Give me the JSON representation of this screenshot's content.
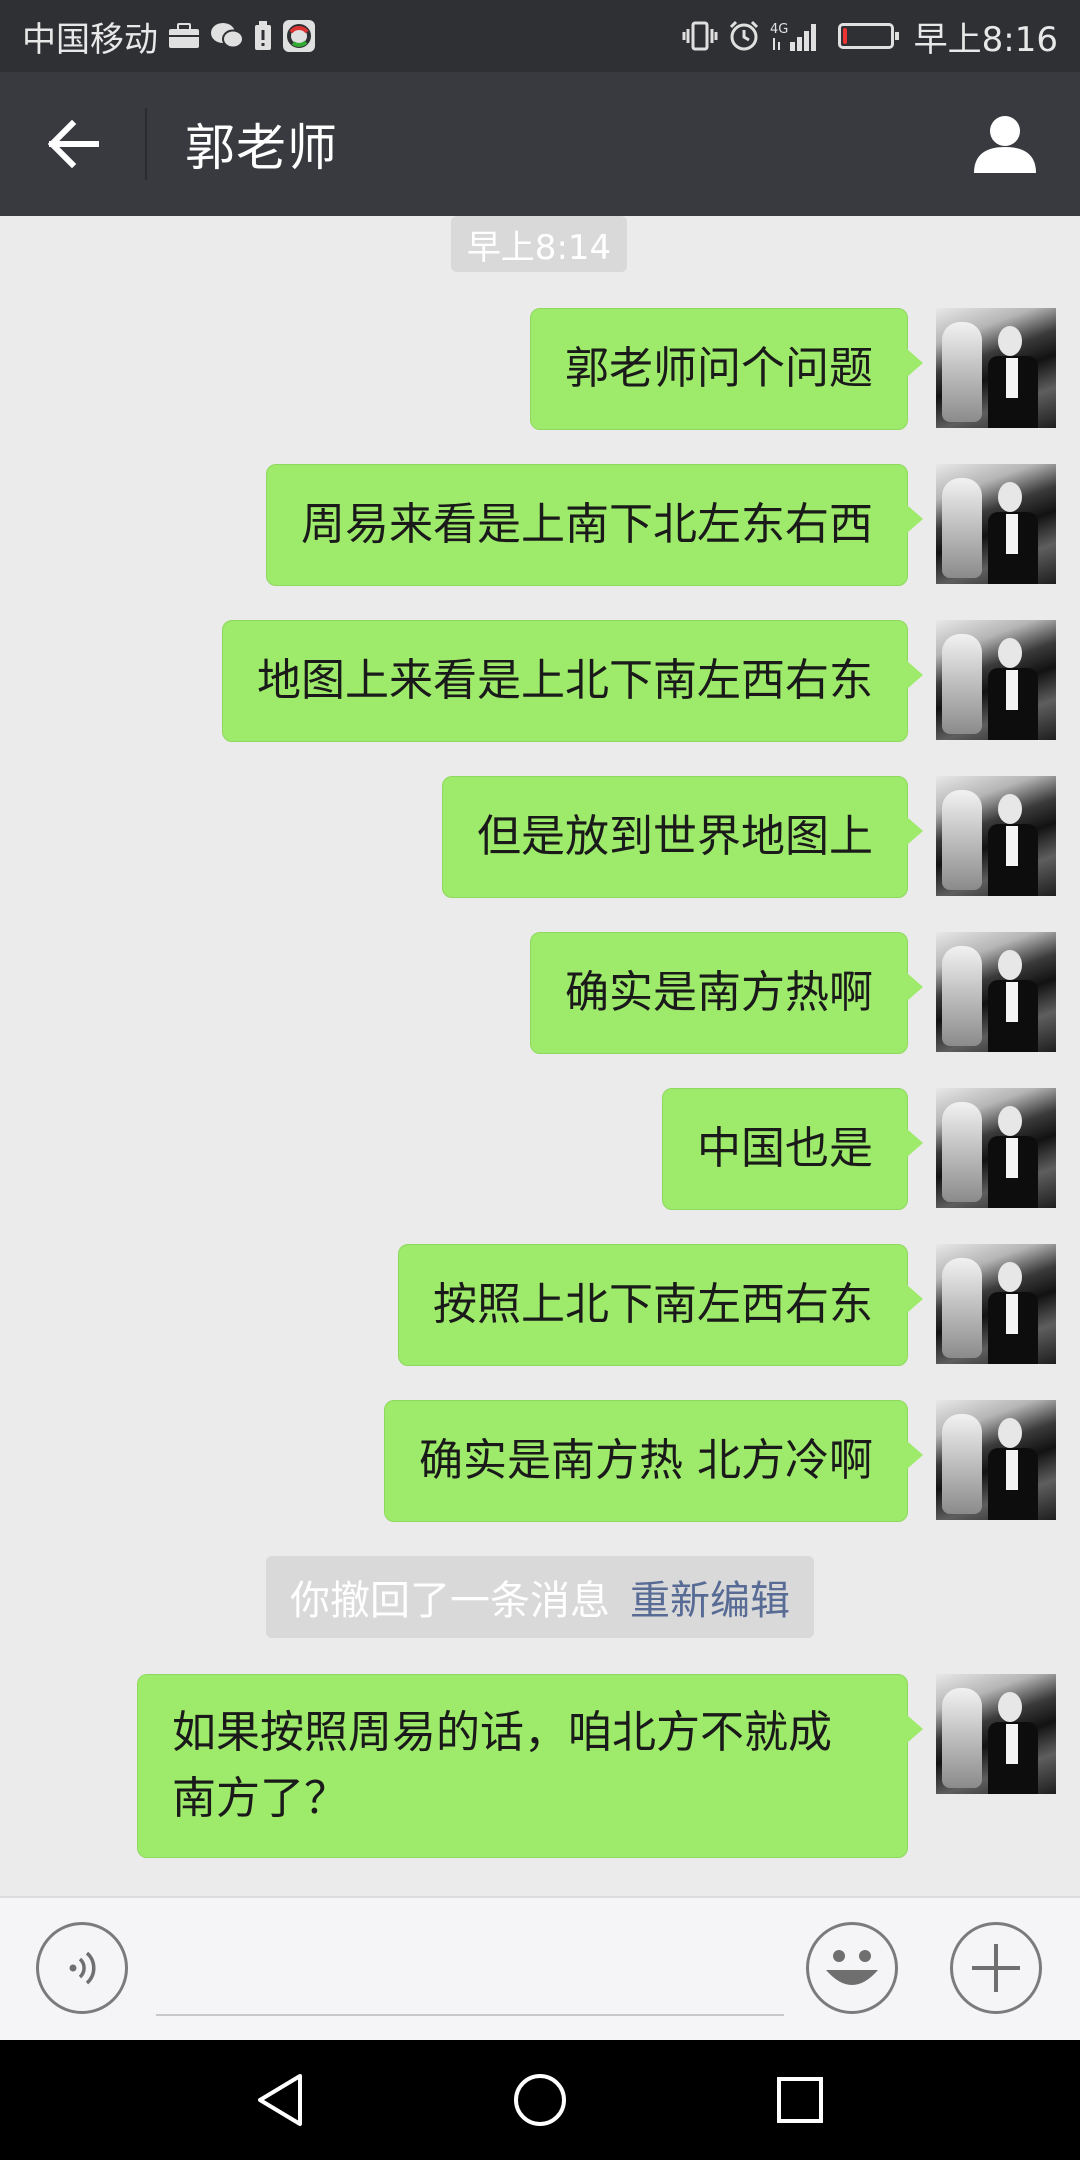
{
  "status_bar": {
    "carrier": "中国移动",
    "network": "4G",
    "time": "早上8:16",
    "battery_level_percent": 8,
    "icons": [
      "briefcase-icon",
      "wechat-icon",
      "battery-saver-icon",
      "app-notification-icon",
      "vibrate-icon",
      "alarm-icon",
      "signal-icon",
      "battery-icon"
    ]
  },
  "header": {
    "title": "郭老师",
    "back_icon": "back-arrow-icon",
    "profile_icon": "person-icon"
  },
  "chat": {
    "timestamp": "早上8:14",
    "messages": [
      {
        "text": "郭老师问个问题"
      },
      {
        "text": "周易来看是上南下北左东右西"
      },
      {
        "text": "地图上来看是上北下南左西右东"
      },
      {
        "text": "但是放到世界地图上"
      },
      {
        "text": "确实是南方热啊"
      },
      {
        "text": "中国也是"
      },
      {
        "text": "按照上北下南左西右东"
      },
      {
        "text": "确实是南方热 北方冷啊"
      }
    ],
    "recall_notice": {
      "text": "你撤回了一条消息",
      "action": "重新编辑"
    },
    "last_message": {
      "text": "如果按照周易的话，咱北方不就成南方了？"
    }
  },
  "input_bar": {
    "voice_icon": "voice-icon",
    "emoji_icon": "emoji-icon",
    "plus_icon": "plus-icon",
    "value": ""
  },
  "nav_bar": {
    "icons": [
      "nav-back-icon",
      "nav-home-icon",
      "nav-recents-icon"
    ]
  },
  "colors": {
    "status_bar": "#2f3034",
    "title_bar": "#393a3f",
    "background": "#ebebeb",
    "bubble_green": "#9eea6a",
    "link_blue": "#576b95"
  }
}
